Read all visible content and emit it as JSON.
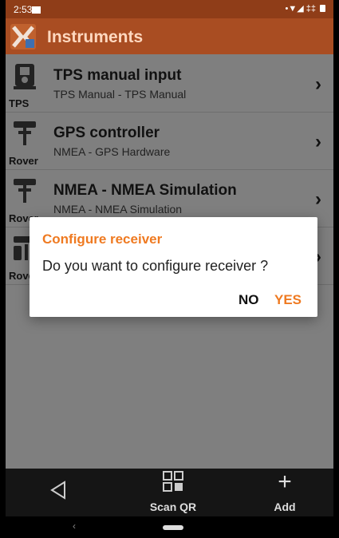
{
  "status": {
    "time": "2:53",
    "signal": "•▼◢ ‡‡"
  },
  "appbar": {
    "title": "Instruments"
  },
  "instruments": [
    {
      "name": "TPS manual input",
      "desc": "TPS Manual - TPS Manual",
      "sub": "TPS"
    },
    {
      "name": "GPS controller",
      "desc": "NMEA - GPS Hardware",
      "sub": "Rover"
    },
    {
      "name": "NMEA - NMEA Simulation",
      "desc": "NMEA - NMEA Simulation",
      "sub": "Rover"
    },
    {
      "name": "",
      "desc": "",
      "sub": "Rover"
    }
  ],
  "chevron": "›",
  "dialog": {
    "title": "Configure receiver",
    "message": "Do you want to configure receiver ?",
    "no": "NO",
    "yes": "YES"
  },
  "bottom": {
    "scan": "Scan QR",
    "add": "Add",
    "plus": "+"
  },
  "navbar": {
    "back": "‹"
  },
  "colors": {
    "accent": "#ef7a21",
    "appbar": "#a94d22",
    "list_dimmed": "#7f7f7f"
  }
}
